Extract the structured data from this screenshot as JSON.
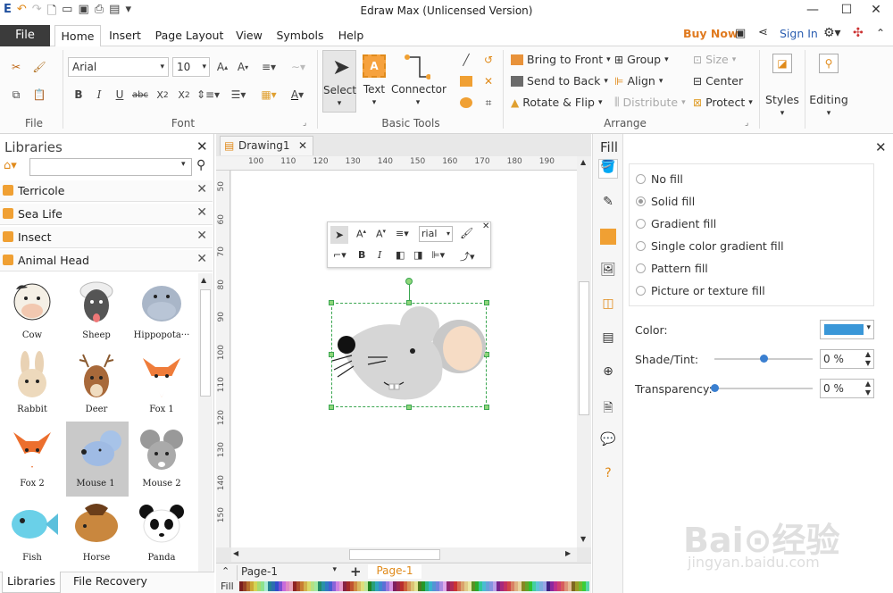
{
  "window": {
    "title": "Edraw Max (Unlicensed Version)"
  },
  "menu": {
    "file": "File",
    "tabs": [
      "Home",
      "Insert",
      "Page Layout",
      "View",
      "Symbols",
      "Help"
    ],
    "buy_now": "Buy Now",
    "sign_in": "Sign In"
  },
  "ribbon": {
    "group_file": "File",
    "group_font": "Font",
    "group_basic_tools": "Basic Tools",
    "group_arrange": "Arrange",
    "font_name": "Arial",
    "font_size": "10",
    "select_label": "Select",
    "text_label": "Text",
    "connector_label": "Connector",
    "bring_to_front": "Bring to Front",
    "send_to_back": "Send to Back",
    "rotate_flip": "Rotate & Flip",
    "group": "Group",
    "align": "Align",
    "distribute": "Distribute",
    "size": "Size",
    "center": "Center",
    "protect": "Protect",
    "styles": "Styles",
    "editing": "Editing"
  },
  "libraries": {
    "title": "Libraries",
    "search_value": "",
    "items": [
      "Terricole",
      "Sea Life",
      "Insect",
      "Animal Head"
    ],
    "shapes": [
      "Cow",
      "Sheep",
      "Hippopota···",
      "Rabbit",
      "Deer",
      "Fox 1",
      "Fox 2",
      "Mouse 1",
      "Mouse 2",
      "Fish",
      "Horse",
      "Panda"
    ],
    "bottom_tabs": [
      "Libraries",
      "File Recovery"
    ]
  },
  "document": {
    "tab": "Drawing1",
    "ruler_h": [
      "100",
      "110",
      "120",
      "130",
      "140",
      "150",
      "160",
      "170",
      "180",
      "190"
    ],
    "ruler_v": [
      "50",
      "60",
      "70",
      "80",
      "90",
      "100",
      "110",
      "120",
      "130",
      "140",
      "150"
    ],
    "mini_toolbar_font": "rial",
    "page_select": "Page-1",
    "page_tab": "Page-1",
    "fill_label": "Fill"
  },
  "fill_panel": {
    "title": "Fill",
    "options": [
      "No fill",
      "Solid fill",
      "Gradient fill",
      "Single color gradient fill",
      "Pattern fill",
      "Picture or texture fill"
    ],
    "selected": "Solid fill",
    "color_label": "Color:",
    "color_value": "#3a97d8",
    "shade_label": "Shade/Tint:",
    "shade_value": "0 %",
    "shade_level": 0.5,
    "transparency_label": "Transparency:",
    "transparency_value": "0 %",
    "transparency_level": 0.0
  },
  "watermark": {
    "main": "Bai⊙经验",
    "sub": "jingyan.baidu.com"
  }
}
